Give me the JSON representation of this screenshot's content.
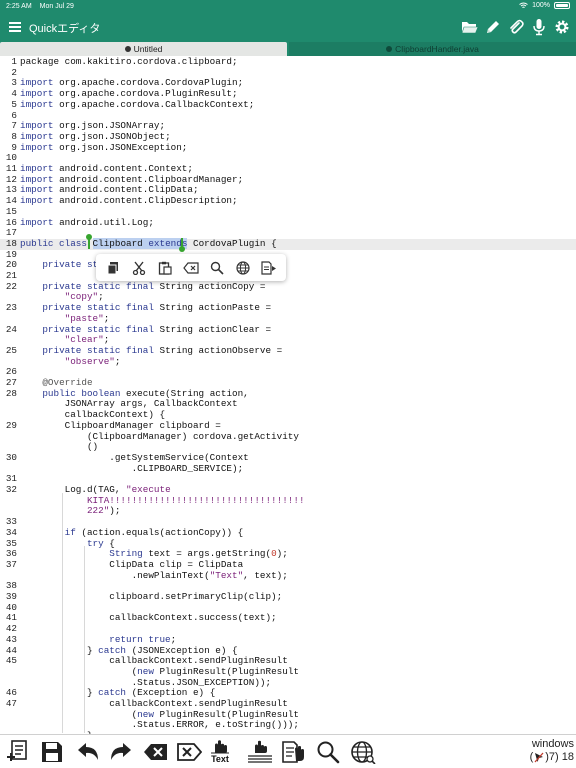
{
  "status_bar": {
    "time": "2:25 AM",
    "date": "Mon Jul 29",
    "battery": "100%"
  },
  "toolbar": {
    "title": "Quickエディタ",
    "icons": [
      "folder-icon",
      "pencil-icon",
      "paperclip-icon",
      "microphone-icon",
      "gear-icon"
    ]
  },
  "tabs": [
    {
      "label": "Untitled",
      "active": true
    },
    {
      "label": "ClipboardHandler.java",
      "active": false
    }
  ],
  "editor": {
    "lines": [
      {
        "n": "1",
        "html": "package com.kakitiro.cordova.clipboard;"
      },
      {
        "n": "2",
        "html": ""
      },
      {
        "n": "3",
        "html": "<span class=\"kw\">import</span> org.apache.cordova.CordovaPlugin;"
      },
      {
        "n": "4",
        "html": "<span class=\"kw\">import</span> org.apache.cordova.PluginResult;"
      },
      {
        "n": "5",
        "html": "<span class=\"kw\">import</span> org.apache.cordova.CallbackContext;"
      },
      {
        "n": "6",
        "html": ""
      },
      {
        "n": "7",
        "html": "<span class=\"kw\">import</span> org.json.JSONArray;"
      },
      {
        "n": "8",
        "html": "<span class=\"kw\">import</span> org.json.JSONObject;"
      },
      {
        "n": "9",
        "html": "<span class=\"kw\">import</span> org.json.JSONException;"
      },
      {
        "n": "10",
        "html": ""
      },
      {
        "n": "11",
        "html": "<span class=\"kw\">import</span> android.content.Context;"
      },
      {
        "n": "12",
        "html": "<span class=\"kw\">import</span> android.content.ClipboardManager;"
      },
      {
        "n": "13",
        "html": "<span class=\"kw\">import</span> android.content.ClipData;"
      },
      {
        "n": "14",
        "html": "<span class=\"kw\">import</span> android.content.ClipDescription;"
      },
      {
        "n": "15",
        "html": ""
      },
      {
        "n": "16",
        "html": "<span class=\"kw\">import</span> android.util.Log;"
      },
      {
        "n": "17",
        "html": ""
      },
      {
        "n": "18",
        "html": "<span class=\"kw\">public class</span> <span class=\"sel\">Clipboard <span class=\"kw\">extends</span></span> CordovaPlugin {",
        "current": true
      },
      {
        "n": "19",
        "html": ""
      },
      {
        "n": "20",
        "html": "    <span class=\"kw\">private sta</span>                              ;"
      },
      {
        "n": "21",
        "html": ""
      },
      {
        "n": "22",
        "html": "    <span class=\"kw\">private static final</span> String actionCopy ="
      },
      {
        "n": "",
        "html": "        <span class=\"st\">\"copy\"</span>;"
      },
      {
        "n": "23",
        "html": "    <span class=\"kw\">private static final</span> String actionPaste ="
      },
      {
        "n": "",
        "html": "        <span class=\"st\">\"paste\"</span>;"
      },
      {
        "n": "24",
        "html": "    <span class=\"kw\">private static final</span> String actionClear ="
      },
      {
        "n": "",
        "html": "        <span class=\"st\">\"clear\"</span>;"
      },
      {
        "n": "25",
        "html": "    <span class=\"kw\">private static final</span> String actionObserve ="
      },
      {
        "n": "",
        "html": "        <span class=\"st\">\"observe\"</span>;"
      },
      {
        "n": "26",
        "html": ""
      },
      {
        "n": "27",
        "html": "    <span class=\"an\">@Override</span>"
      },
      {
        "n": "28",
        "html": "    <span class=\"kw\">public boolean</span> execute(String action,"
      },
      {
        "n": "",
        "html": "        JSONArray args, CallbackContext"
      },
      {
        "n": "",
        "html": "        callbackContext) {"
      },
      {
        "n": "29",
        "html": "        ClipboardManager clipboard ="
      },
      {
        "n": "",
        "html": "            (ClipboardManager) cordova.getActivity"
      },
      {
        "n": "",
        "html": "            ()"
      },
      {
        "n": "30",
        "html": "                .getSystemService(Context"
      },
      {
        "n": "",
        "html": "                    .CLIPBOARD_SERVICE);"
      },
      {
        "n": "31",
        "html": ""
      },
      {
        "n": "32",
        "html": "        Log.d(TAG, <span class=\"st\">\"execute</span>"
      },
      {
        "n": "",
        "html": "            <span class=\"st\">KITA!!!!!!!!!!!!!!!!!!!!!!!!!!!!!!!!!!!</span>"
      },
      {
        "n": "",
        "html": "            <span class=\"st\">222\"</span>);"
      },
      {
        "n": "33",
        "html": ""
      },
      {
        "n": "34",
        "html": "        <span class=\"kw\">if</span> (action.equals(actionCopy)) {"
      },
      {
        "n": "35",
        "html": "            <span class=\"kw\">try</span> {"
      },
      {
        "n": "36",
        "html": "                <span class=\"kw\">String</span> text = args.getString(<span class=\"nu\">0</span>);"
      },
      {
        "n": "37",
        "html": "                ClipData clip = ClipData"
      },
      {
        "n": "",
        "html": "                    .newPlainText(<span class=\"st\">\"Text\"</span>, text);"
      },
      {
        "n": "38",
        "html": ""
      },
      {
        "n": "39",
        "html": "                clipboard.setPrimaryClip(clip);"
      },
      {
        "n": "40",
        "html": ""
      },
      {
        "n": "41",
        "html": "                callbackContext.success(text);"
      },
      {
        "n": "42",
        "html": ""
      },
      {
        "n": "43",
        "html": "                <span class=\"kw\">return true</span>;"
      },
      {
        "n": "44",
        "html": "            } <span class=\"kw\">catch</span> (JSONException e) {"
      },
      {
        "n": "45",
        "html": "                callbackContext.sendPluginResult"
      },
      {
        "n": "",
        "html": "                    (<span class=\"kw\">new</span> PluginResult(PluginResult"
      },
      {
        "n": "",
        "html": "                    .Status.JSON_EXCEPTION));"
      },
      {
        "n": "46",
        "html": "            } <span class=\"kw\">catch</span> (Exception e) {"
      },
      {
        "n": "47",
        "html": "                callbackContext.sendPluginResult"
      },
      {
        "n": "",
        "html": "                    (<span class=\"kw\">new</span> PluginResult(PluginResult"
      },
      {
        "n": "",
        "html": "                    .Status.ERROR, e.toString()));"
      },
      {
        "n": "",
        "html": "            }"
      }
    ]
  },
  "context_menu": {
    "items": [
      "copy-icon",
      "cut-icon",
      "paste-icon",
      "delete-icon",
      "search-icon",
      "web-icon",
      "more-icon"
    ]
  },
  "bottom_bar": {
    "text_label": "Text",
    "status_line1": "windows",
    "status_line2": ")7) 18"
  }
}
